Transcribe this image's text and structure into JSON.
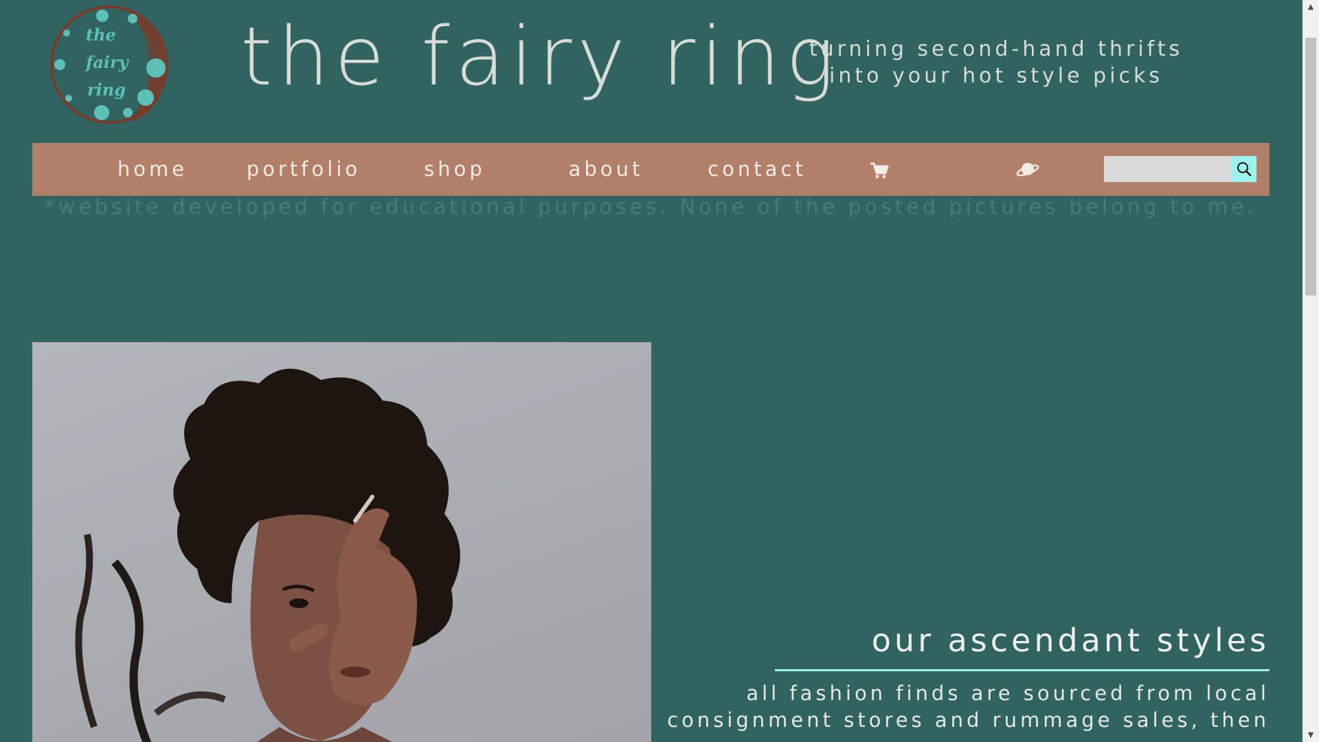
{
  "header": {
    "logo_lines": [
      "the",
      "fairy",
      "ring"
    ],
    "site_title": "the fairy ring",
    "tagline": "turning second-hand thrifts into your hot style picks"
  },
  "nav": {
    "items": [
      {
        "label": "home"
      },
      {
        "label": "portfolio"
      },
      {
        "label": "shop"
      },
      {
        "label": "about"
      },
      {
        "label": "contact"
      }
    ],
    "cart_icon": "cart-icon",
    "planet_icon": "planet-icon",
    "search": {
      "placeholder": "",
      "button_icon": "search-icon"
    }
  },
  "disclaimer": "*website developed for educational purposes. None of the posted pictures belong to me.",
  "section": {
    "title": "our ascendant styles",
    "body": "all fashion finds are sourced from local consignment stores and rummage sales, then"
  },
  "colors": {
    "background": "#316460",
    "nav_bar": "#b27f69",
    "accent": "#9ef2ee"
  }
}
